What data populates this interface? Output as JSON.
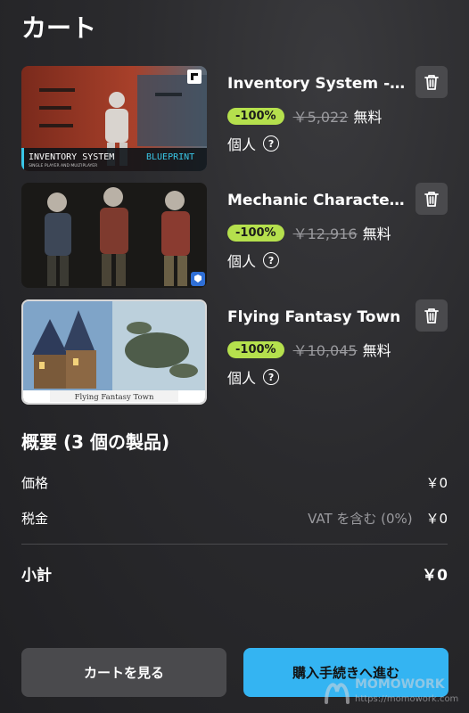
{
  "header": {
    "title": "カート"
  },
  "cart": {
    "items": [
      {
        "name": "Inventory System - Full",
        "discount": "-100%",
        "original_price": "￥5,022",
        "final_price": "無料",
        "license": "個人",
        "thumb_caption": "INVENTORY SYSTEM",
        "thumb_tag": "BLUEPRINT",
        "thumb_sub": "SINGLE PLAYER AND MULTIPLAYER"
      },
      {
        "name": "Mechanic Character Pack",
        "discount": "-100%",
        "original_price": "￥12,916",
        "final_price": "無料",
        "license": "個人"
      },
      {
        "name": "Flying Fantasy Town",
        "discount": "-100%",
        "original_price": "￥10,045",
        "final_price": "無料",
        "license": "個人",
        "thumb_caption": "Flying Fantasy Town"
      }
    ]
  },
  "summary": {
    "title": "概要 (3 個の製品)",
    "price_label": "価格",
    "price_value": "￥0",
    "tax_label": "税金",
    "tax_note": "VAT を含む (0%)",
    "tax_value": "￥0",
    "subtotal_label": "小計",
    "subtotal_value": "￥0"
  },
  "buttons": {
    "view_cart": "カートを見る",
    "checkout": "購入手続きへ進む"
  },
  "watermark": {
    "name": "MOMOWORK",
    "url": "https://momowork.com"
  },
  "colors": {
    "discount_badge": "#b5e04d",
    "checkout_button": "#34b4f2",
    "background": "#2a2a2d"
  },
  "icons": {
    "trash": "trash-icon",
    "help": "help-circle-icon"
  }
}
